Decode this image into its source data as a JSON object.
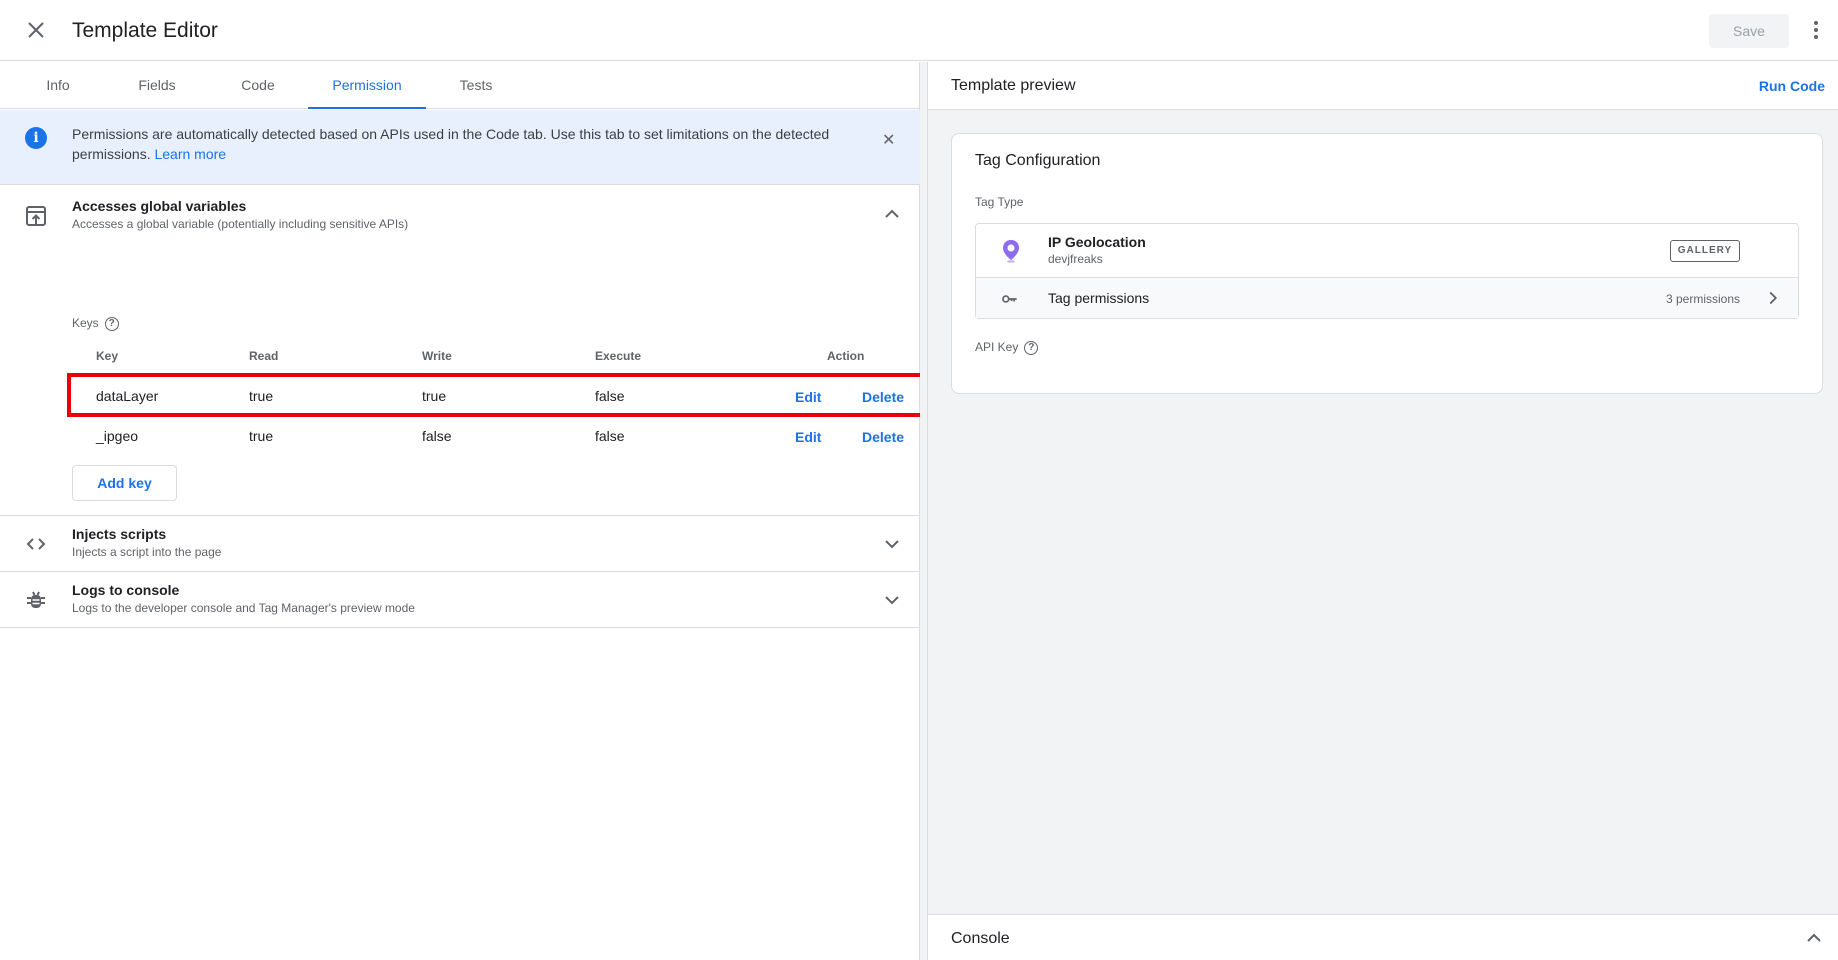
{
  "header": {
    "title": "Template Editor",
    "save_label": "Save"
  },
  "tabs": [
    {
      "label": "Info"
    },
    {
      "label": "Fields"
    },
    {
      "label": "Code"
    },
    {
      "label": "Permission"
    },
    {
      "label": "Tests"
    }
  ],
  "active_tab": "Permission",
  "banner": {
    "text": "Permissions are automatically detected based on APIs used in the Code tab. Use this tab to set limitations on the detected permissions.",
    "link": "Learn more"
  },
  "permissions": [
    {
      "title": "Accesses global variables",
      "subtitle": "Accesses a global variable (potentially including sensitive APIs)",
      "expanded": true
    },
    {
      "title": "Injects scripts",
      "subtitle": "Injects a script into the page",
      "expanded": false
    },
    {
      "title": "Logs to console",
      "subtitle": "Logs to the developer console and Tag Manager's preview mode",
      "expanded": false
    }
  ],
  "keys": {
    "label": "Keys",
    "headers": {
      "key": "Key",
      "read": "Read",
      "write": "Write",
      "execute": "Execute",
      "action": "Action"
    },
    "rows": [
      {
        "key": "dataLayer",
        "read": "true",
        "write": "true",
        "execute": "false",
        "edit": "Edit",
        "delete": "Delete"
      },
      {
        "key": "_ipgeo",
        "read": "true",
        "write": "false",
        "execute": "false",
        "edit": "Edit",
        "delete": "Delete"
      }
    ],
    "add_label": "Add key"
  },
  "preview": {
    "title": "Template preview",
    "run_label": "Run Code",
    "card_title": "Tag Configuration",
    "tag_type_label": "Tag Type",
    "tag_name": "IP Geolocation",
    "tag_author": "devjfreaks",
    "gallery_badge": "GALLERY",
    "tag_permissions_label": "Tag permissions",
    "tag_permissions_count": "3 permissions",
    "api_key_label": "API Key"
  },
  "console": {
    "label": "Console"
  },
  "colors": {
    "accent": "#1a73e8",
    "highlight": "#e8000b",
    "banner_bg": "#e8f0fe",
    "pin_purple": "#8e6cf0"
  }
}
